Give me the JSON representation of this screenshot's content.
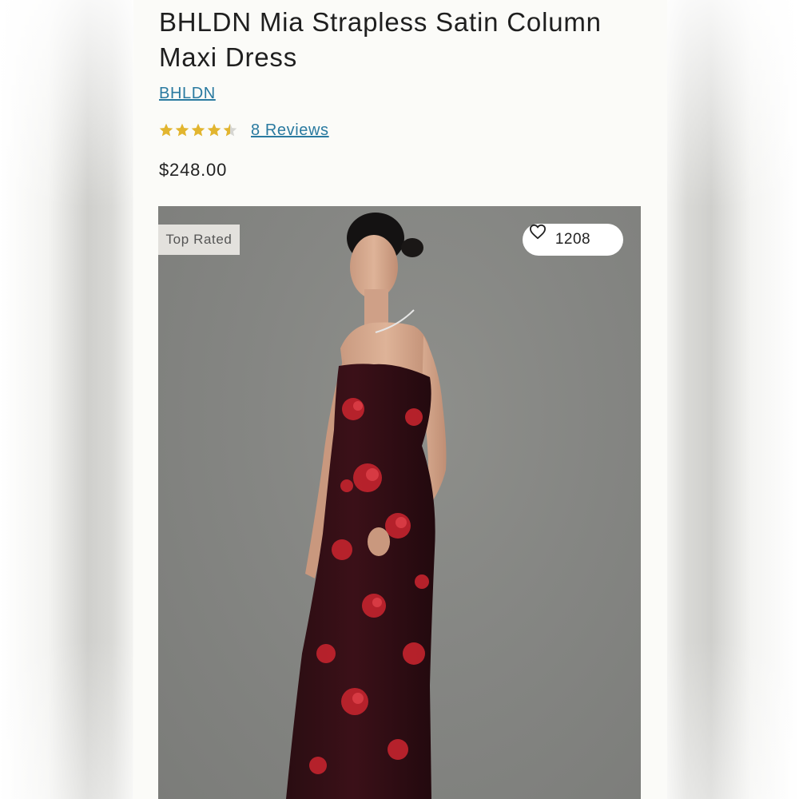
{
  "product": {
    "title": "BHLDN Mia Strapless Satin Column Maxi Dress",
    "brand": "BHLDN",
    "rating": 4.5,
    "rating_max": 5,
    "reviews_label": "8 Reviews",
    "price": "$248.00"
  },
  "gallery": {
    "badge": "Top Rated",
    "favorites_count": "1208",
    "favorite_icon": "heart-outline-icon"
  },
  "colors": {
    "star": "#e2b52f",
    "link": "#2a7aa0",
    "background": "#fbfbf8",
    "photo_bg": "#858683"
  }
}
